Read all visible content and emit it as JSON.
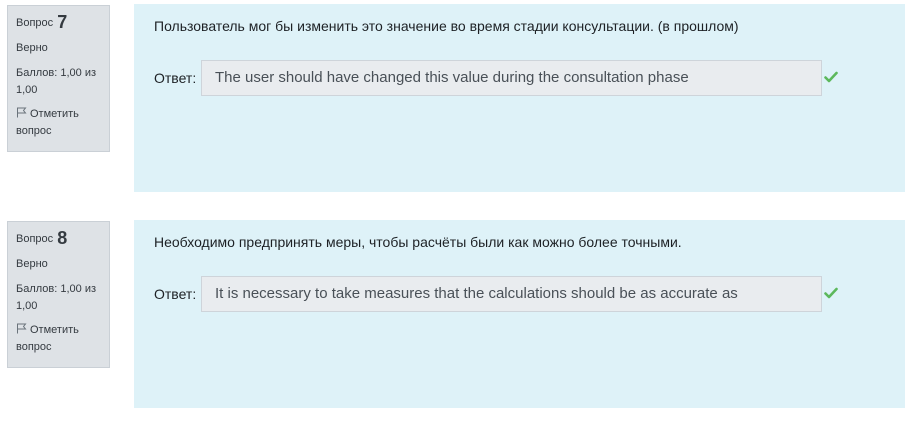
{
  "questions": [
    {
      "question_label": "Вопрос",
      "number": "7",
      "state": "Верно",
      "grade_line1": "Баллов: 1,00 из",
      "grade_line2": "1,00",
      "flag_line1": "Отметить",
      "flag_line2": "вопрос",
      "text": "Пользователь мог бы изменить это значение во время стадии консультации. (в прошлом)",
      "answer_label": "Ответ:",
      "answer_value": "The user should have changed this value during the consultation phase",
      "icon": "check-icon",
      "correct": true
    },
    {
      "question_label": "Вопрос",
      "number": "8",
      "state": "Верно",
      "grade_line1": "Баллов: 1,00 из",
      "grade_line2": "1,00",
      "flag_line1": "Отметить",
      "flag_line2": "вопрос",
      "text": "Необходимо предпринять меры, чтобы расчёты были как можно более точными.",
      "answer_label": "Ответ:",
      "answer_value": "It is necessary to take measures that the calculations should be as accurate as",
      "icon": "check-icon",
      "correct": true
    }
  ],
  "colors": {
    "info_bg": "#dee2e6",
    "content_bg": "#def2f8",
    "answer_bg": "#e9ecef",
    "check": "#5cb85c"
  }
}
